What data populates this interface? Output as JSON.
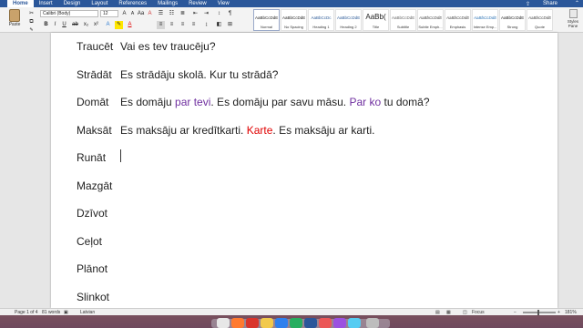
{
  "ribbon": {
    "tabs": [
      "Home",
      "Insert",
      "Design",
      "Layout",
      "References",
      "Mailings",
      "Review",
      "View"
    ],
    "share_label": "Share",
    "paste_label": "Paste",
    "font_name": "Calibri (Body)",
    "font_size": "12",
    "styles": [
      {
        "sample": "AaBbCcDdEe",
        "name": "Normal"
      },
      {
        "sample": "AaBbCcDdEe",
        "name": "No Spacing"
      },
      {
        "sample": "AaBbCcDc",
        "name": "Heading 1"
      },
      {
        "sample": "AaBbCcDdEe",
        "name": "Heading 2"
      },
      {
        "sample": "AaBb(",
        "name": "Title"
      },
      {
        "sample": "AaBbCcDdEe",
        "name": "Subtitle"
      },
      {
        "sample": "AaBbCcDdEe",
        "name": "Subtle Emph..."
      },
      {
        "sample": "AaBbCcDdEe",
        "name": "Emphasis"
      },
      {
        "sample": "AaBbCcDdEe",
        "name": "Intense Emp..."
      },
      {
        "sample": "AaBbCcDdEe",
        "name": "Strong"
      },
      {
        "sample": "AaBbCcDdEe",
        "name": "Quote"
      }
    ],
    "styles_pane_label": "Styles Pane"
  },
  "document": {
    "rows": [
      {
        "word": "Traucēt",
        "sentence": [
          {
            "t": " Vai es tev traucēju?",
            "c": ""
          }
        ]
      },
      {
        "word": "Strādāt",
        "sentence": [
          {
            "t": "Es strādāju skolā. Kur tu strādā?",
            "c": ""
          }
        ]
      },
      {
        "word": "Domāt",
        "sentence": [
          {
            "t": "Es domāju ",
            "c": ""
          },
          {
            "t": "par tevi",
            "c": "purple"
          },
          {
            "t": ". Es domāju par savu māsu. ",
            "c": ""
          },
          {
            "t": "Par ko",
            "c": "purple"
          },
          {
            "t": " tu domā?",
            "c": ""
          }
        ]
      },
      {
        "word": "Maksāt",
        "sentence": [
          {
            "t": "Es maksāju ar kredītkarti. ",
            "c": ""
          },
          {
            "t": "Karte",
            "c": "red"
          },
          {
            "t": ". Es maksāju ar karti.",
            "c": ""
          }
        ]
      },
      {
        "word": "Runāt",
        "sentence": []
      },
      {
        "word": "Mazgāt",
        "sentence": []
      },
      {
        "word": "Dzīvot",
        "sentence": []
      },
      {
        "word": "Ceļot",
        "sentence": []
      },
      {
        "word": "Plānot",
        "sentence": []
      },
      {
        "word": "Slinkot",
        "sentence": []
      }
    ]
  },
  "status": {
    "page": "Page 1 of 4",
    "words": "81 words",
    "language": "Latvian",
    "focus": "Focus",
    "zoom": "181%",
    "zoom_level_pct": 45
  },
  "colors": {
    "ribbon_blue": "#2b579a",
    "purple_text": "#7030a0",
    "red_text": "#e00000"
  }
}
